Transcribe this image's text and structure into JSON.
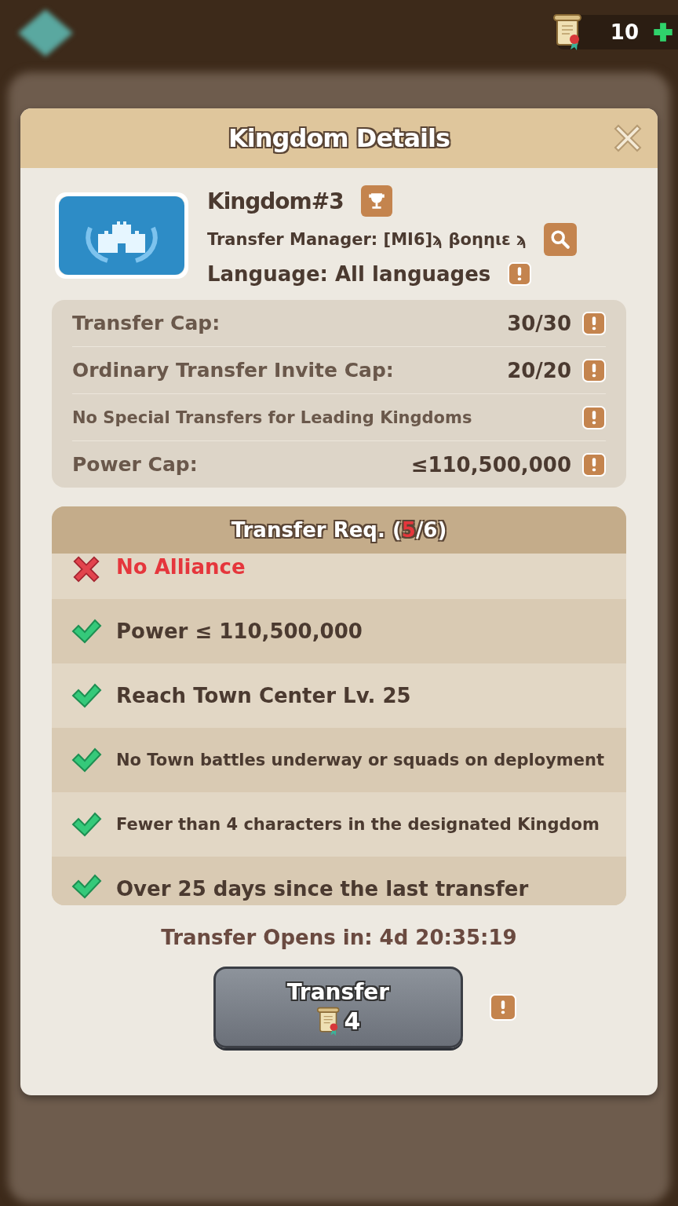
{
  "top_bar": {
    "scrolls": "10"
  },
  "dialog": {
    "title": "Kingdom Details",
    "kingdom": {
      "name": "Kingdom#3",
      "manager": "Transfer Manager: [MI6]ϡ βοηηιε ϡ",
      "language": "Language: All languages"
    },
    "caps": [
      {
        "label": "Transfer Cap:",
        "value": "30/30",
        "kind": "large"
      },
      {
        "label": "Ordinary Transfer Invite Cap:",
        "value": "20/20",
        "kind": "large"
      },
      {
        "label": "No Special Transfers for Leading Kingdoms",
        "kind": "small"
      },
      {
        "label": "Power Cap:",
        "value": "≤110,500,000",
        "kind": "large"
      }
    ],
    "requirements": {
      "title_start": "Transfer Req. (",
      "met_count": "5",
      "title_end": "/6)",
      "all_met": false,
      "items": [
        {
          "text": "No Alliance",
          "met": false
        },
        {
          "text": "Power ≤ 110,500,000",
          "met": true
        },
        {
          "text": "Reach Town Center Lv. 25",
          "met": true
        },
        {
          "text": "No Town battles underway or squads on deployment",
          "met": true
        },
        {
          "text": "Fewer than 4 characters in the designated Kingdom",
          "met": true
        },
        {
          "text": "Over 25 days since the last transfer",
          "met": true
        }
      ]
    },
    "countdown": "Transfer Opens in: 4d 20:35:19",
    "transfer_button": {
      "label": "Transfer",
      "cost": "4"
    }
  }
}
